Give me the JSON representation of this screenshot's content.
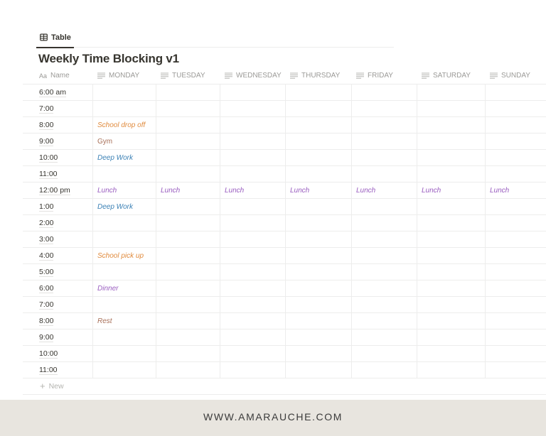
{
  "view_tab": {
    "label": "Table",
    "icon": "table-icon"
  },
  "database": {
    "title": "Weekly Time Blocking v1"
  },
  "columns": [
    {
      "label": "Name",
      "icon": "title-aa-icon",
      "icon_text": "Aa"
    },
    {
      "label": "MONDAY",
      "icon": "text-lines-icon"
    },
    {
      "label": "TUESDAY",
      "icon": "text-lines-icon"
    },
    {
      "label": "WEDNESDAY",
      "icon": "text-lines-icon"
    },
    {
      "label": "THURSDAY",
      "icon": "text-lines-icon"
    },
    {
      "label": "FRIDAY",
      "icon": "text-lines-icon"
    },
    {
      "label": "SATURDAY",
      "icon": "text-lines-icon"
    },
    {
      "label": "SUNDAY",
      "icon": "text-lines-icon"
    }
  ],
  "colors": {
    "orange": "#e08a3c",
    "brown": "#a87059",
    "blue": "#3a80b5",
    "purple": "#9a5ec0"
  },
  "rows": [
    {
      "name": "6:00 am",
      "cells": [
        "",
        "",
        "",
        "",
        "",
        "",
        ""
      ]
    },
    {
      "name": "7:00",
      "cells": [
        "",
        "",
        "",
        "",
        "",
        "",
        ""
      ]
    },
    {
      "name": "8:00",
      "cells": [
        "School drop off",
        "",
        "",
        "",
        "",
        "",
        ""
      ],
      "styles": [
        "orange-italic"
      ]
    },
    {
      "name": "9:00",
      "cells": [
        "Gym",
        "",
        "",
        "",
        "",
        "",
        ""
      ],
      "styles": [
        "brown"
      ]
    },
    {
      "name": "10:00",
      "cells": [
        "Deep Work",
        "",
        "",
        "",
        "",
        "",
        ""
      ],
      "styles": [
        "blue-italic"
      ]
    },
    {
      "name": "11:00",
      "cells": [
        "",
        "",
        "",
        "",
        "",
        "",
        ""
      ]
    },
    {
      "name": "12:00 pm",
      "cells": [
        "Lunch",
        "Lunch",
        "Lunch",
        "Lunch",
        "Lunch",
        "Lunch",
        "Lunch"
      ],
      "styles": [
        "purple-italic",
        "purple-italic",
        "purple-italic",
        "purple-italic",
        "purple-italic",
        "purple-italic",
        "purple-italic"
      ]
    },
    {
      "name": "1:00",
      "cells": [
        "Deep Work",
        "",
        "",
        "",
        "",
        "",
        ""
      ],
      "styles": [
        "blue-italic"
      ]
    },
    {
      "name": "2:00",
      "cells": [
        "",
        "",
        "",
        "",
        "",
        "",
        ""
      ]
    },
    {
      "name": "3:00",
      "cells": [
        "",
        "",
        "",
        "",
        "",
        "",
        ""
      ]
    },
    {
      "name": "4:00",
      "cells": [
        "School pick up",
        "",
        "",
        "",
        "",
        "",
        ""
      ],
      "styles": [
        "orange-italic"
      ]
    },
    {
      "name": "5:00",
      "cells": [
        "",
        "",
        "",
        "",
        "",
        "",
        ""
      ]
    },
    {
      "name": "6:00",
      "cells": [
        "Dinner",
        "",
        "",
        "",
        "",
        "",
        ""
      ],
      "styles": [
        "purple-italic"
      ]
    },
    {
      "name": "7:00",
      "cells": [
        "",
        "",
        "",
        "",
        "",
        "",
        ""
      ]
    },
    {
      "name": "8:00",
      "cells": [
        "Rest",
        "",
        "",
        "",
        "",
        "",
        ""
      ],
      "styles": [
        "brown-italic"
      ]
    },
    {
      "name": "9:00",
      "cells": [
        "",
        "",
        "",
        "",
        "",
        "",
        ""
      ]
    },
    {
      "name": "10:00",
      "cells": [
        "",
        "",
        "",
        "",
        "",
        "",
        ""
      ]
    },
    {
      "name": "11:00",
      "cells": [
        "",
        "",
        "",
        "",
        "",
        "",
        ""
      ]
    }
  ],
  "new_row": {
    "label": "New",
    "icon": "plus-icon"
  },
  "footer": {
    "text": "WWW.AMARAUCHE.COM"
  }
}
